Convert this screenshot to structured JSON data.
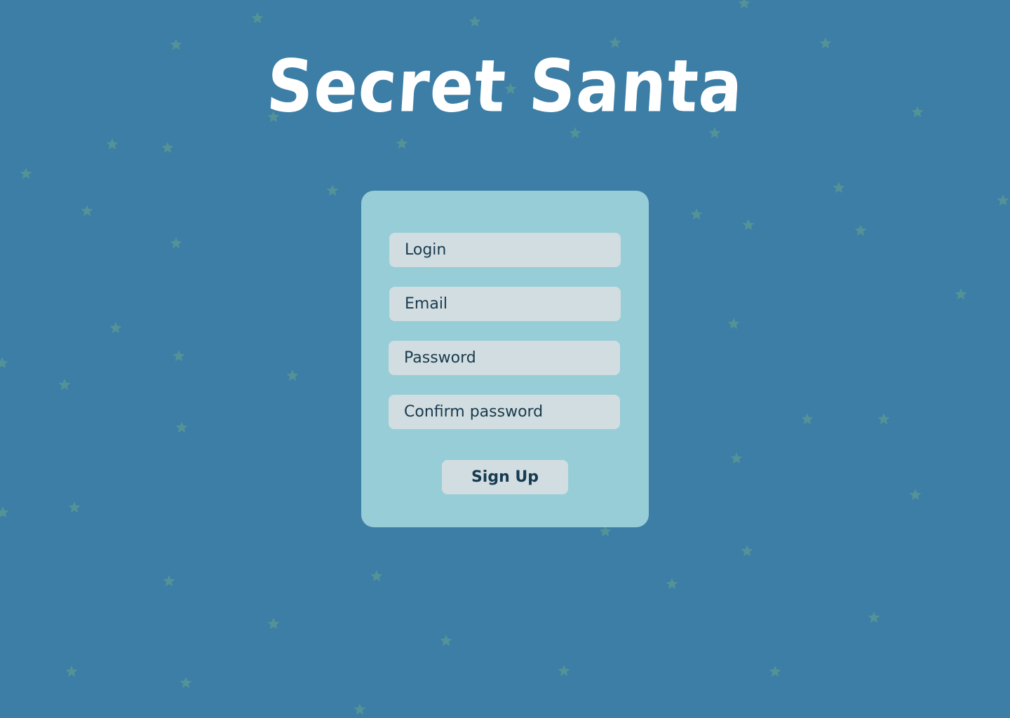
{
  "app": {
    "title": "Secret Santa"
  },
  "form": {
    "login_placeholder": "Login",
    "email_placeholder": "Email",
    "password_placeholder": "Password",
    "confirm_password_placeholder": "Confirm password",
    "submit_label": "Sign Up"
  },
  "colors": {
    "background": "#3c7ea5",
    "card": "#97cdd7",
    "field": "#d1dde0",
    "text": "#1a3a4e",
    "title": "#ffffff",
    "star": "#5b9a93"
  },
  "decoration": {
    "background_icon": "star-icon"
  }
}
